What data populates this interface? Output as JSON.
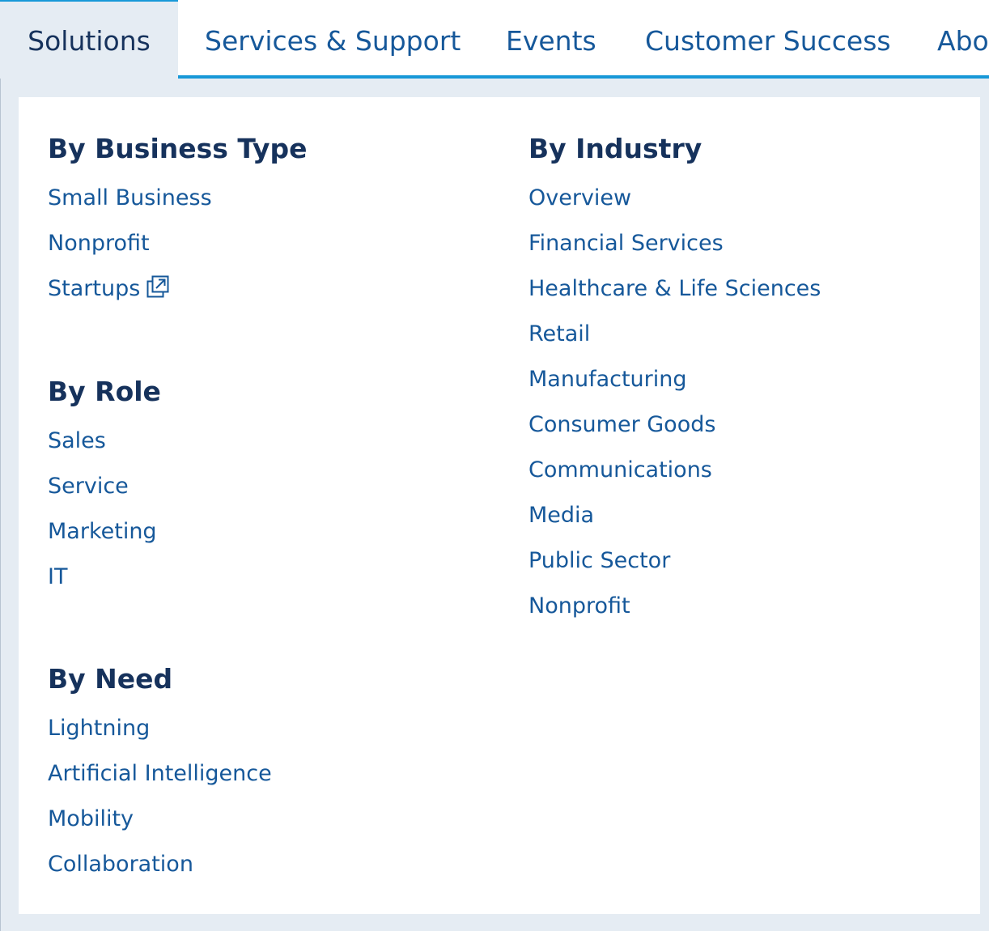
{
  "nav": {
    "tabs": [
      {
        "label": "Solutions",
        "active": true
      },
      {
        "label": "Services & Support"
      },
      {
        "label": "Events"
      },
      {
        "label": "Customer Success"
      },
      {
        "label": "Abo"
      }
    ],
    "accent_color": "#1798d8"
  },
  "menu": {
    "business_type": {
      "heading": "By Business Type",
      "items": [
        "Small Business",
        "Nonprofit",
        "Startups"
      ],
      "external_item_icon": "external-link-icon"
    },
    "role": {
      "heading": "By Role",
      "items": [
        "Sales",
        "Service",
        "Marketing",
        "IT"
      ]
    },
    "need": {
      "heading": "By Need",
      "items": [
        "Lightning",
        "Artificial Intelligence",
        "Mobility",
        "Collaboration"
      ]
    },
    "industry": {
      "heading": "By Industry",
      "items": [
        "Overview",
        "Financial Services",
        "Healthcare & Life Sciences",
        "Retail",
        "Manufacturing",
        "Consumer Goods",
        "Communications",
        "Media",
        "Public Sector",
        "Nonprofit"
      ]
    }
  },
  "colors": {
    "heading": "#16325c",
    "link": "#16589a",
    "panel_background": "#e5ecf3"
  }
}
